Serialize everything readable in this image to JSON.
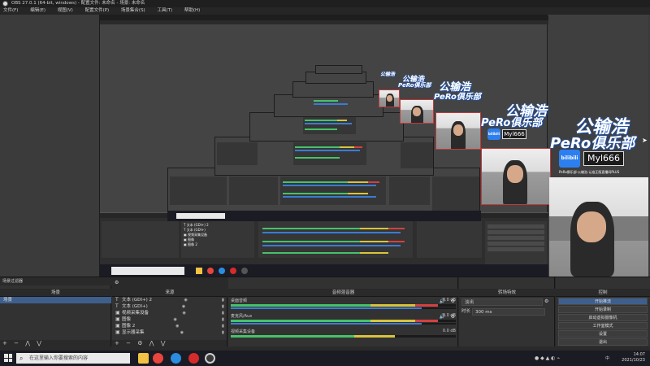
{
  "window": {
    "title": "OBS 27.0.1 (64-bit, windows) - 配置文件: 未命名 - 场景: 未命名"
  },
  "menu": [
    "文件(F)",
    "编辑(E)",
    "视图(V)",
    "配置文件(P)",
    "场景集合(S)",
    "工具(T)",
    "帮助(H)"
  ],
  "overlay": {
    "brand_name": "公输浩",
    "club_name": "PeRo俱乐部",
    "platform": "bilibili",
    "user_id": "Myl666",
    "slogan": "PeRo俱乐部·公输浩·认准正版直播间PLUS"
  },
  "docks": {
    "scenes": {
      "header": "场景",
      "items": [
        "场景"
      ]
    },
    "sources": {
      "header": "来源",
      "items": [
        {
          "icon": "T",
          "name": "文本 (GDI+) 2"
        },
        {
          "icon": "T",
          "name": "文本 (GDI+)"
        },
        {
          "icon": "▣",
          "name": "视频采集设备"
        },
        {
          "icon": "▣",
          "name": "图像"
        },
        {
          "icon": "▣",
          "name": "图像 2"
        },
        {
          "icon": "▣",
          "name": "显示器采集"
        }
      ]
    },
    "mixer": {
      "header": "音频混音器",
      "channels": [
        {
          "name": "桌面音频",
          "db": "0.0 dB"
        },
        {
          "name": "麦克风/Aux",
          "db": "0.0 dB"
        },
        {
          "name": "视频采集设备",
          "db": "0.0 dB"
        }
      ]
    },
    "transitions": {
      "header": "转场特效",
      "type": "淡出",
      "duration_label": "时长",
      "duration": "300 ms"
    },
    "controls": {
      "header": "控制",
      "buttons": [
        "开始推流",
        "开始录制",
        "启动虚拟摄像机",
        "工作室模式",
        "设置",
        "退出"
      ]
    },
    "scene_filter_label": "场景过滤器"
  },
  "taskbar": {
    "search_placeholder": "在这里输入你要搜索的内容",
    "time": "14:07",
    "date": "2021/10/23",
    "lang": "中",
    "apps": [
      {
        "name": "file-explorer",
        "color": "#f3c343"
      },
      {
        "name": "chrome",
        "color": "#e8453c"
      },
      {
        "name": "edge",
        "color": "#2a8de0"
      },
      {
        "name": "netease-music",
        "color": "#d62b2b"
      },
      {
        "name": "obs",
        "color": "#3a3a3a"
      }
    ]
  },
  "colors": {
    "accent": "#3e5f8c",
    "meter_green": "#46c26a",
    "meter_yellow": "#d8c43c",
    "meter_red": "#d44040",
    "volume_blue": "#3a7bd5"
  }
}
